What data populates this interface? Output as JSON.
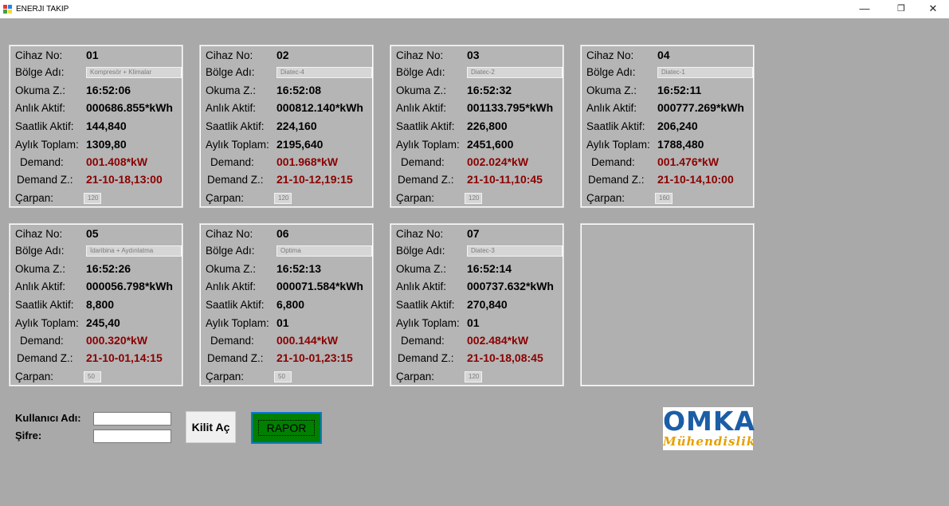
{
  "window": {
    "title": "ENERJI TAKIP",
    "min": "—",
    "max": "❐",
    "close": "✕"
  },
  "labels": {
    "device_no": "Cihaz No:",
    "region": "Bölge Adı:",
    "read_time": "Okuma Z.:",
    "instant_active": "Anlık Aktif:",
    "hourly_active": "Saatlik Aktif:",
    "monthly_total": "Aylık Toplam:",
    "demand": "Demand:",
    "demand_time": "Demand Z.:",
    "multiplier": "Çarpan:"
  },
  "devices": [
    {
      "no": "01",
      "region": "Kompresör + Klimalar",
      "read_time": "16:52:06",
      "instant": "000686.855*kWh",
      "hourly": "144,840",
      "monthly": "1309,80",
      "demand": "001.408*kW",
      "demand_time": "21-10-18,13:00",
      "multiplier": "120"
    },
    {
      "no": "02",
      "region": "Diatec-4",
      "read_time": "16:52:08",
      "instant": "000812.140*kWh",
      "hourly": "224,160",
      "monthly": "2195,640",
      "demand": "001.968*kW",
      "demand_time": "21-10-12,19:15",
      "multiplier": "120"
    },
    {
      "no": "03",
      "region": "Diatec-2",
      "read_time": "16:52:32",
      "instant": "001133.795*kWh",
      "hourly": "226,800",
      "monthly": "2451,600",
      "demand": "002.024*kW",
      "demand_time": "21-10-11,10:45",
      "multiplier": "120"
    },
    {
      "no": "04",
      "region": "Diatec-1",
      "read_time": "16:52:11",
      "instant": "000777.269*kWh",
      "hourly": "206,240",
      "monthly": "1788,480",
      "demand": "001.476*kW",
      "demand_time": "21-10-14,10:00",
      "multiplier": "160"
    },
    {
      "no": "05",
      "region": "İdaribina + Aydınlatma",
      "read_time": "16:52:26",
      "instant": "000056.798*kWh",
      "hourly": "8,800",
      "monthly": "245,40",
      "demand": "000.320*kW",
      "demand_time": "21-10-01,14:15",
      "multiplier": "50"
    },
    {
      "no": "06",
      "region": "Optima",
      "read_time": "16:52:13",
      "instant": "000071.584*kWh",
      "hourly": "6,800",
      "monthly": "01",
      "demand": "000.144*kW",
      "demand_time": "21-10-01,23:15",
      "multiplier": "50"
    },
    {
      "no": "07",
      "region": "Diatec-3",
      "read_time": "16:52:14",
      "instant": "000737.632*kWh",
      "hourly": "270,840",
      "monthly": "01",
      "demand": "002.484*kW",
      "demand_time": "21-10-18,08:45",
      "multiplier": "120"
    }
  ],
  "login": {
    "username_label": "Kullanıcı Adı:",
    "password_label": "Şifre:",
    "username_value": "",
    "password_value": "",
    "unlock_button": "Kilit Aç",
    "report_button": "RAPOR"
  },
  "logo": {
    "top": "OMKA",
    "bottom": "Mühendislik"
  },
  "colors": {
    "background": "#a9a9a9",
    "panel": "#b5b5b5",
    "demand_text": "#8b0000",
    "report_button": "#008000",
    "logo_blue": "#1b5ea6",
    "logo_orange": "#e6a000"
  }
}
